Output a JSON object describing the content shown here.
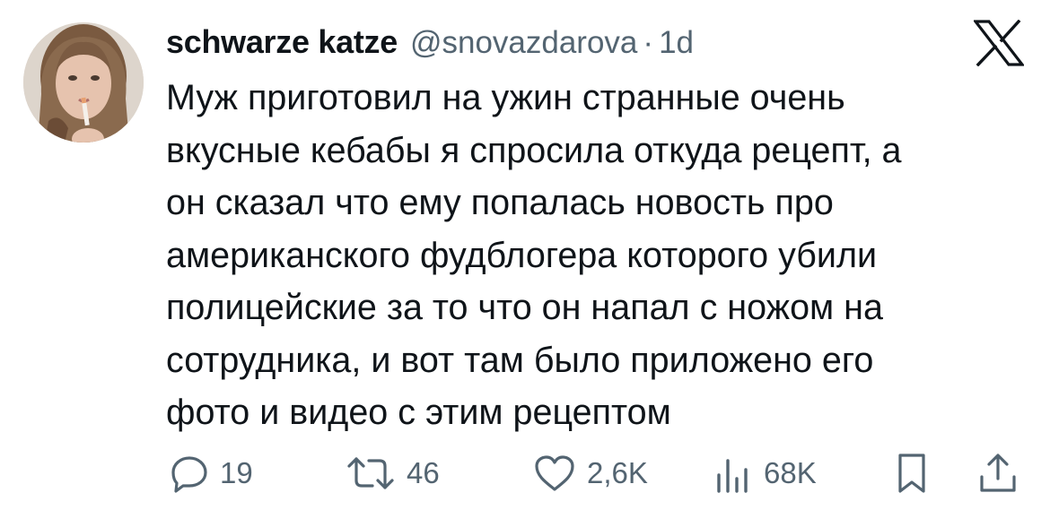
{
  "tweet": {
    "display_name": "schwarze katze",
    "handle": "@snovazdarova",
    "separator": "·",
    "timestamp": "1d",
    "logo_icon": "x-logo-icon",
    "lines": [
      "Муж приготовил на ужин странные очень",
      "вкусные кебабы я спросила откуда рецепт, а",
      "он сказал что ему попалась новость про",
      "американского фудблогера которого убили",
      "полицейские за то что он напал с ножом на",
      "сотрудника, и вот там было приложено его",
      "фото и видео с этим рецептом"
    ]
  },
  "actions": {
    "reply": {
      "icon": "reply-icon",
      "count": "19"
    },
    "repost": {
      "icon": "repost-icon",
      "count": "46"
    },
    "like": {
      "icon": "heart-icon",
      "count": "2,6K"
    },
    "views": {
      "icon": "views-icon",
      "count": "68K"
    },
    "bookmark": {
      "icon": "bookmark-icon"
    },
    "share": {
      "icon": "share-icon"
    }
  },
  "colors": {
    "text": "#0f1419",
    "secondary": "#536471",
    "background": "#ffffff"
  }
}
